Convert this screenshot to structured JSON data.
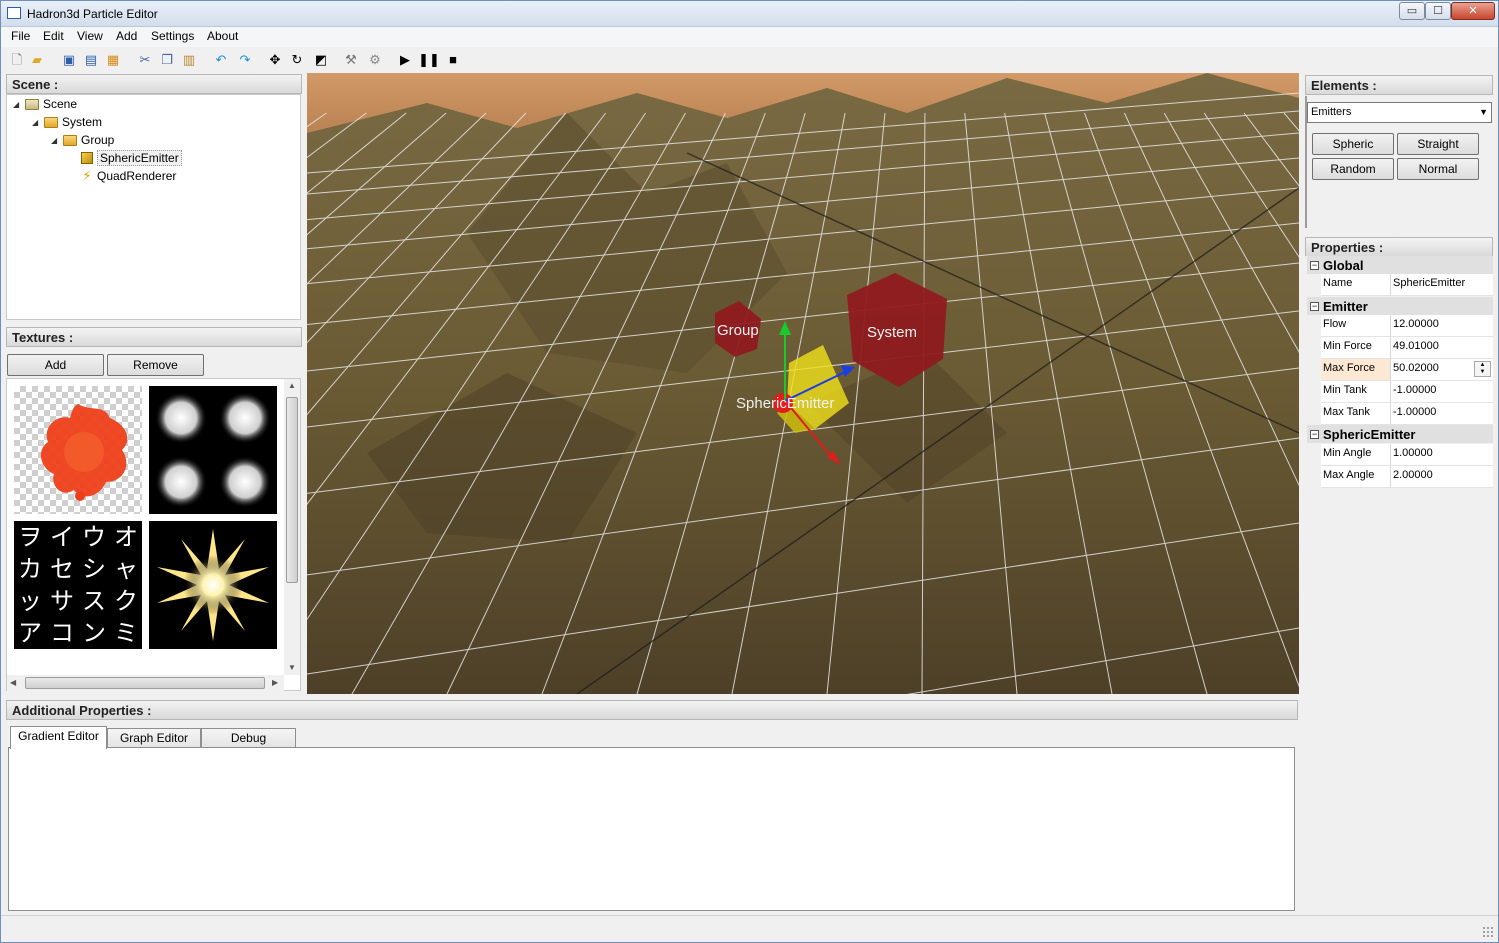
{
  "window": {
    "title": "Hadron3d Particle Editor",
    "min_glyph": "▭",
    "max_glyph": "☐",
    "close_glyph": "✕"
  },
  "menu": [
    "File",
    "Edit",
    "View",
    "Add",
    "Settings",
    "About"
  ],
  "toolbar_icons": [
    {
      "name": "new-file-icon",
      "glyph": "🗋",
      "color": "#777777"
    },
    {
      "name": "open-folder-icon",
      "glyph": "▰",
      "color": "#e0a72b"
    },
    {
      "name": "save-icon",
      "glyph": "▣",
      "color": "#2f5fa8"
    },
    {
      "name": "save-all-icon",
      "glyph": "▤",
      "color": "#2f5fa8"
    },
    {
      "name": "export-icon",
      "glyph": "▦",
      "color": "#d58a18"
    },
    {
      "name": "cut-icon",
      "glyph": "✂",
      "color": "#3b66b0"
    },
    {
      "name": "copy-icon",
      "glyph": "❐",
      "color": "#3b66b0"
    },
    {
      "name": "paste-icon",
      "glyph": "▥",
      "color": "#b8862b"
    },
    {
      "name": "undo-icon",
      "glyph": "↶",
      "color": "#1e8fd8"
    },
    {
      "name": "redo-icon",
      "glyph": "↷",
      "color": "#1e8fd8"
    },
    {
      "name": "move-icon",
      "glyph": "✥",
      "color": "#000000"
    },
    {
      "name": "rotate-icon",
      "glyph": "↻",
      "color": "#000000"
    },
    {
      "name": "scale-icon",
      "glyph": "◩",
      "color": "#000000"
    },
    {
      "name": "wrench-icon",
      "glyph": "⚒",
      "color": "#777777"
    },
    {
      "name": "gear-icon",
      "glyph": "⚙",
      "color": "#888888"
    },
    {
      "name": "play-icon",
      "glyph": "▶",
      "color": "#000000"
    },
    {
      "name": "pause-icon",
      "glyph": "❚❚",
      "color": "#000000"
    },
    {
      "name": "stop-icon",
      "glyph": "■",
      "color": "#000000"
    }
  ],
  "scene": {
    "header": "Scene :",
    "tree": [
      {
        "label": "Scene",
        "icon": "scene-icon",
        "depth": 0
      },
      {
        "label": "System",
        "icon": "folder-icon",
        "depth": 1
      },
      {
        "label": "Group",
        "icon": "folder-icon",
        "depth": 2
      },
      {
        "label": "SphericEmitter",
        "icon": "emitter-cube-icon",
        "depth": 3,
        "selected": true
      },
      {
        "label": "QuadRenderer",
        "icon": "renderer-bolt-icon",
        "depth": 3
      }
    ]
  },
  "textures": {
    "header": "Textures :",
    "add_label": "Add",
    "remove_label": "Remove",
    "kana": [
      "ヲ",
      "イ",
      "ウ",
      "オ",
      "カ",
      "セ",
      "シ",
      "ャ",
      "ッ",
      "サ",
      "ス",
      "ク",
      "ア",
      "コ",
      "ン",
      "ミ"
    ]
  },
  "viewport": {
    "labels": {
      "group": "Group",
      "system": "System",
      "emitter": "SphericEmitter"
    },
    "colors": {
      "node": "#8f1a1f",
      "axis_x": "#e21b1b",
      "axis_y": "#19c92e",
      "axis_z": "#1b3ee2",
      "emitter": "#f1e11c"
    }
  },
  "elements": {
    "header": "Elements :",
    "dropdown_value": "Emitters",
    "buttons": [
      "Spheric",
      "Straight",
      "Random",
      "Normal"
    ]
  },
  "properties": {
    "header": "Properties :",
    "categories": [
      {
        "name": "Global",
        "rows": [
          {
            "key": "Name",
            "value": "SphericEmitter"
          }
        ]
      },
      {
        "name": "Emitter",
        "rows": [
          {
            "key": "Flow",
            "value": "12.00000"
          },
          {
            "key": "Min Force",
            "value": "49.01000"
          },
          {
            "key": "Max Force",
            "value": "50.02000",
            "active": true
          },
          {
            "key": "Min Tank",
            "value": "-1.00000"
          },
          {
            "key": "Max Tank",
            "value": "-1.00000"
          }
        ]
      },
      {
        "name": "SphericEmitter",
        "rows": [
          {
            "key": "Min Angle",
            "value": "1.00000"
          },
          {
            "key": "Max Angle",
            "value": "2.00000"
          }
        ]
      }
    ]
  },
  "additional": {
    "header": "Additional Properties :",
    "tabs": [
      "Gradient Editor",
      "Graph Editor",
      "Debug"
    ]
  }
}
